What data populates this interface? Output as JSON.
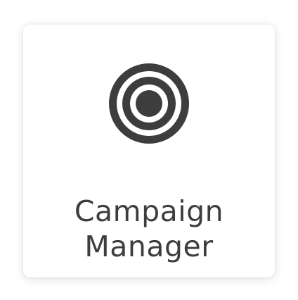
{
  "tile": {
    "icon": "target-icon",
    "title_line1": "Campaign",
    "title_line2": "Manager",
    "icon_color": "#3d3d3d",
    "text_color": "#3d3d3d"
  }
}
